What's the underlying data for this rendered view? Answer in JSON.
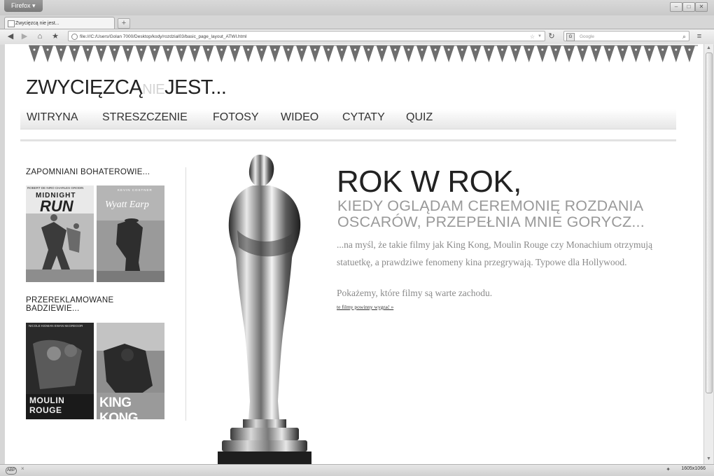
{
  "browser": {
    "app_button": "Firefox ▾",
    "tab_title": "Zwycięzcą nie jest...",
    "new_tab": "+",
    "url": "file:///C:/Users/Golan 7000/Desktop/kody/rozdzial03/basic_page_layout_ATWI.html",
    "search_placeholder": "Google",
    "search_engine_icon": "G",
    "status_resolution": "1605x1066",
    "status_close": "×",
    "status_icon": "ABP"
  },
  "page": {
    "title_main": "ZWYCIĘZCĄ",
    "title_nie": "NIE",
    "title_end": "JEST...",
    "menu": [
      "WITRYNA",
      "STRESZCZENIE",
      "FOTOSY",
      "WIDEO",
      "CYTATY",
      "QUIZ"
    ],
    "sidebar": {
      "section1_title": "ZAPOMNIANI BOHATEROWIE...",
      "section2_title_line1": "PRZEREKLAMOWANE",
      "section2_title_line2": "BADZIEWIE...",
      "posters": {
        "p1_actors": "ROBERT DE NIRO   CHARLES GRODIN",
        "p1_title_a": "MIDNIGHT",
        "p1_title_b": "RUN",
        "p2_actor": "KEVIN COSTNER",
        "p2_title": "Wyatt Earp",
        "p3_actors": "NICOLE KIDMAN   EWAN McGREGOR",
        "p3_title": "MOULIN ROUGE",
        "p4_title": "KING KONG"
      }
    },
    "main": {
      "headline": "ROK W ROK,",
      "subhead": "KIEDY OGLĄDAM CEREMONIĘ ROZDANIA OSCARÓW, PRZEPEŁNIA MNIE GORYCZ...",
      "body": "...na myśl, że takie filmy jak King Kong, Moulin Rouge czy Monachium otrzymują statuetkę, a prawdziwe fenomeny kina przegrywają. Typowe dla Hollywood.",
      "body2": "Pokażemy, które filmy są warte zachodu.",
      "link": "te filmy powinny wygrać »"
    }
  },
  "icons": [
    "back-icon",
    "forward-icon",
    "home-icon",
    "bookmarks-icon",
    "reload-icon",
    "star-icon",
    "search-icon",
    "addon-icon"
  ]
}
